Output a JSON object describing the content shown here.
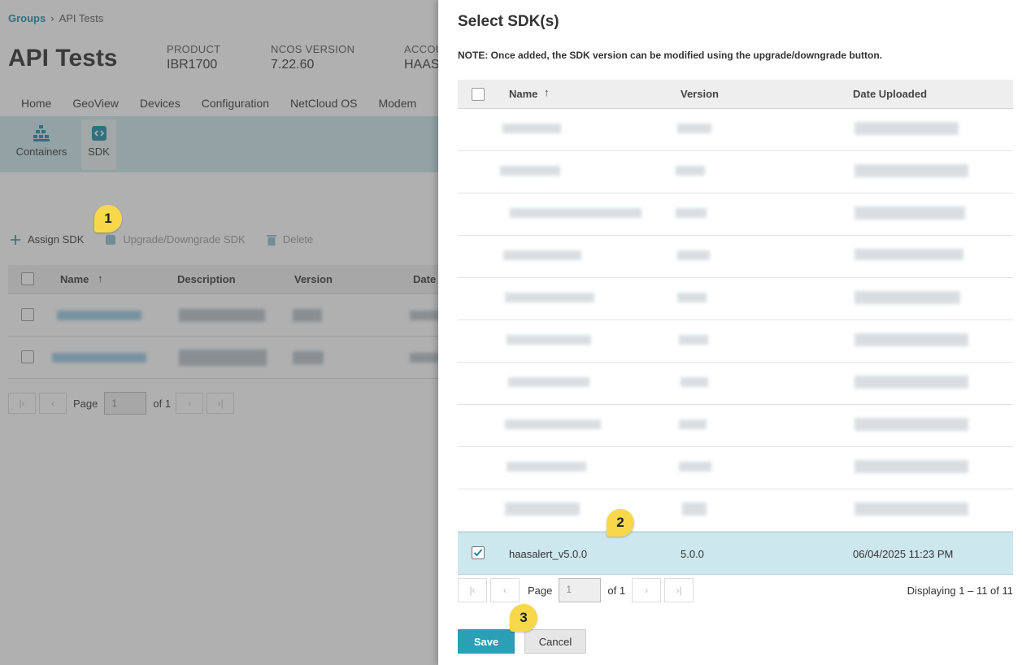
{
  "breadcrumb": {
    "root": "Groups",
    "current": "API Tests"
  },
  "page_title": "API Tests",
  "meta": [
    {
      "label": "PRODUCT",
      "value": "IBR1700"
    },
    {
      "label": "NCOS VERSION",
      "value": "7.22.60"
    },
    {
      "label": "ACCOU",
      "value": "HAAS"
    }
  ],
  "nav_tabs": [
    "Home",
    "GeoView",
    "Devices",
    "Configuration",
    "NetCloud OS",
    "Modem"
  ],
  "sub_nav": [
    {
      "label": "Containers",
      "icon": "containers-icon"
    },
    {
      "label": "SDK",
      "icon": "sdk-icon"
    }
  ],
  "toolbar": {
    "assign": "Assign SDK",
    "upgrade": "Upgrade/Downgrade SDK",
    "delete": "Delete"
  },
  "bg_table": {
    "columns": [
      "Name",
      "Description",
      "Version",
      "Date"
    ]
  },
  "bg_pager": {
    "page_label": "Page",
    "page_value": "1",
    "of_label": "of 1"
  },
  "badges": [
    "1",
    "2",
    "3"
  ],
  "modal": {
    "title": "Select SDK(s)",
    "note": "NOTE: Once added, the SDK version can be modified using the upgrade/downgrade button.",
    "columns": [
      "Name",
      "Version",
      "Date Uploaded"
    ],
    "selected_row": {
      "name": "haasalert_v5.0.0",
      "version": "5.0.0",
      "date": "06/04/2025 11:23 PM"
    },
    "pager": {
      "page_label": "Page",
      "page_value": "1",
      "of_label": "of 1",
      "displaying": "Displaying 1 – 11 of 11"
    },
    "save": "Save",
    "cancel": "Cancel"
  },
  "colors": {
    "accent": "#2a9fb6",
    "selected_row": "#cde7ee",
    "badge": "#f7d84a",
    "subbar": "#c9e6ec"
  }
}
